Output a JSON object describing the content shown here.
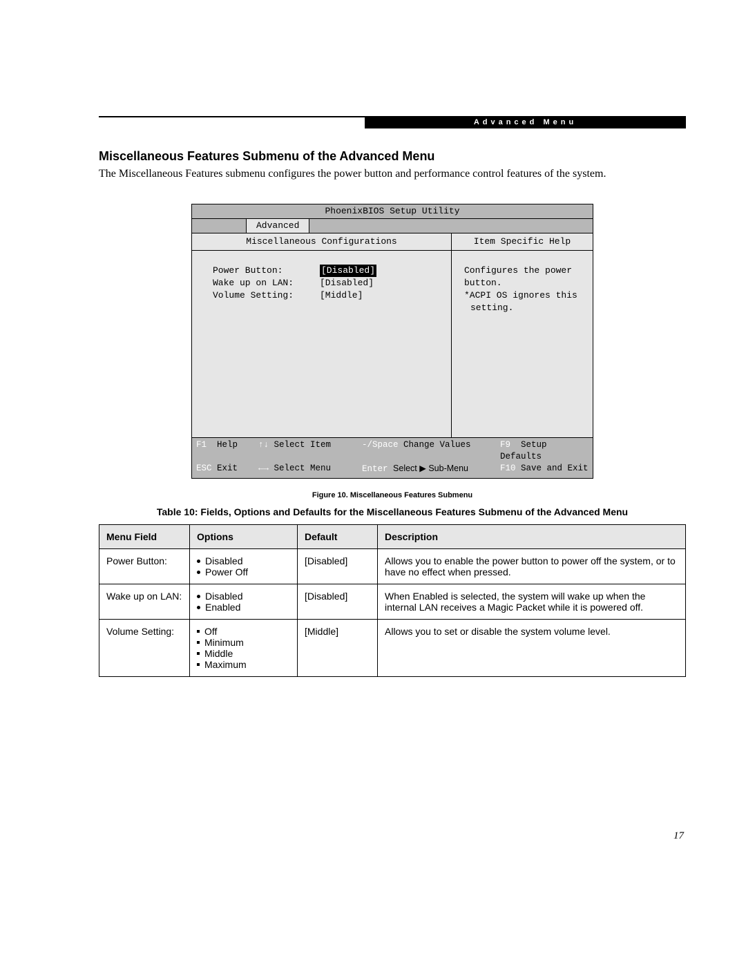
{
  "header": {
    "section_tag": "Advanced Menu"
  },
  "section": {
    "heading": "Miscellaneous Features Submenu of the Advanced Menu",
    "intro": "The Miscellaneous Features submenu configures the power button and performance control features of the system."
  },
  "bios": {
    "title": "PhoenixBIOS Setup Utility",
    "active_tab": "Advanced",
    "subheading_left": "Miscellaneous Configurations",
    "subheading_right": "Item Specific Help",
    "fields": [
      {
        "label": "Power Button:",
        "value": "[Disabled]",
        "selected": true
      },
      {
        "label": "Wake up on LAN:",
        "value": "[Disabled]",
        "selected": false
      },
      {
        "label": "Volume Setting:",
        "value": "[Middle]",
        "selected": false
      }
    ],
    "help_lines": [
      "Configures the power button.",
      "",
      "*ACPI OS ignores this",
      " setting."
    ],
    "footer": {
      "row1": {
        "k1": "F1",
        "t1": "Help",
        "k2": "↑↓",
        "t2": "Select Item",
        "k3": "-/Space",
        "t3": "Change Values",
        "k4": "F9",
        "t4": "Setup Defaults"
      },
      "row2": {
        "k1": "ESC",
        "t1": "Exit",
        "k2": "←→",
        "t2": "Select Menu",
        "k3": "Enter",
        "t3": "Select ▶ Sub-Menu",
        "k4": "F10",
        "t4": "Save and Exit"
      }
    }
  },
  "figure_caption": "Figure 10.  Miscellaneous Features Submenu",
  "table_caption": "Table 10: Fields, Options and Defaults for the Miscellaneous Features Submenu of the Advanced Menu",
  "table": {
    "headers": [
      "Menu Field",
      "Options",
      "Default",
      "Description"
    ],
    "rows": [
      {
        "menu": "Power Button:",
        "options": [
          "Disabled",
          "Power Off"
        ],
        "option_style": "disc",
        "default": "[Disabled]",
        "desc": "Allows you to enable the power button to power off the system, or to have no effect when pressed."
      },
      {
        "menu": "Wake up on LAN:",
        "options": [
          "Disabled",
          "Enabled"
        ],
        "option_style": "disc",
        "default": "[Disabled]",
        "desc": "When Enabled is selected, the system will wake up when the internal LAN receives a Magic Packet while it is powered off."
      },
      {
        "menu": "Volume Setting:",
        "options": [
          "Off",
          "Minimum",
          "Middle",
          "Maximum"
        ],
        "option_style": "square",
        "default": "[Middle]",
        "desc": "Allows you to set or disable the system volume level."
      }
    ]
  },
  "page_number": "17"
}
